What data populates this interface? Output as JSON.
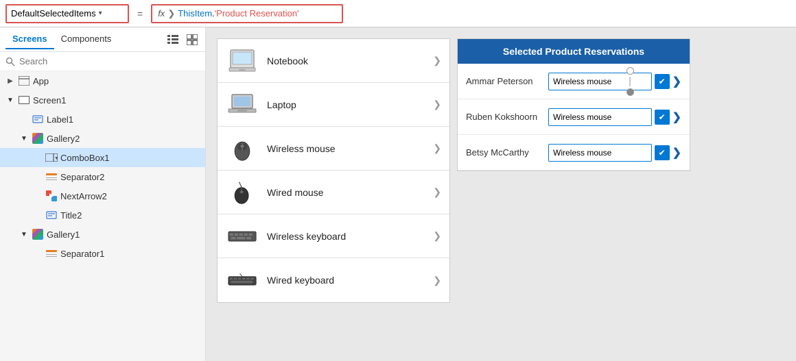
{
  "topbar": {
    "property_label": "DefaultSelectedItems",
    "equals": "=",
    "fx_label": "fx",
    "formula_part1": "ThisItem",
    "formula_dot": ".",
    "formula_part2": "'Product Reservation'"
  },
  "sidebar": {
    "tabs": [
      {
        "id": "screens",
        "label": "Screens",
        "active": true
      },
      {
        "id": "components",
        "label": "Components",
        "active": false
      }
    ],
    "search_placeholder": "Search",
    "tree": [
      {
        "id": "app",
        "label": "App",
        "level": 0,
        "type": "app",
        "expanded": false
      },
      {
        "id": "screen1",
        "label": "Screen1",
        "level": 0,
        "type": "screen",
        "expanded": true
      },
      {
        "id": "label1",
        "label": "Label1",
        "level": 1,
        "type": "label",
        "expanded": false
      },
      {
        "id": "gallery2",
        "label": "Gallery2",
        "level": 1,
        "type": "gallery",
        "expanded": true
      },
      {
        "id": "combobox1",
        "label": "ComboBox1",
        "level": 2,
        "type": "combobox",
        "expanded": false,
        "selected": true
      },
      {
        "id": "separator2",
        "label": "Separator2",
        "level": 2,
        "type": "separator",
        "expanded": false
      },
      {
        "id": "nextarrow2",
        "label": "NextArrow2",
        "level": 2,
        "type": "arrow",
        "expanded": false
      },
      {
        "id": "title2",
        "label": "Title2",
        "level": 2,
        "type": "label",
        "expanded": false
      },
      {
        "id": "gallery1",
        "label": "Gallery1",
        "level": 1,
        "type": "gallery",
        "expanded": true
      },
      {
        "id": "separator1",
        "label": "Separator1",
        "level": 2,
        "type": "separator",
        "expanded": false
      }
    ]
  },
  "canvas": {
    "products": [
      {
        "id": "notebook",
        "name": "Notebook",
        "type": "notebook"
      },
      {
        "id": "laptop",
        "name": "Laptop",
        "type": "laptop"
      },
      {
        "id": "wireless-mouse",
        "name": "Wireless mouse",
        "type": "wireless-mouse"
      },
      {
        "id": "wired-mouse",
        "name": "Wired mouse",
        "type": "wired-mouse"
      },
      {
        "id": "wireless-keyboard",
        "name": "Wireless keyboard",
        "type": "wireless-keyboard"
      },
      {
        "id": "wired-keyboard",
        "name": "Wired keyboard",
        "type": "wired-keyboard"
      }
    ],
    "reservations_header": "Selected Product Reservations",
    "reservations": [
      {
        "id": "ammar",
        "name": "Ammar Peterson",
        "value": "Wireless mouse",
        "open": true
      },
      {
        "id": "ruben",
        "name": "Ruben Kokshoorn",
        "value": "Wireless mouse",
        "open": false
      },
      {
        "id": "betsy",
        "name": "Betsy McCarthy",
        "value": "Wireless mouse",
        "open": false
      }
    ]
  }
}
